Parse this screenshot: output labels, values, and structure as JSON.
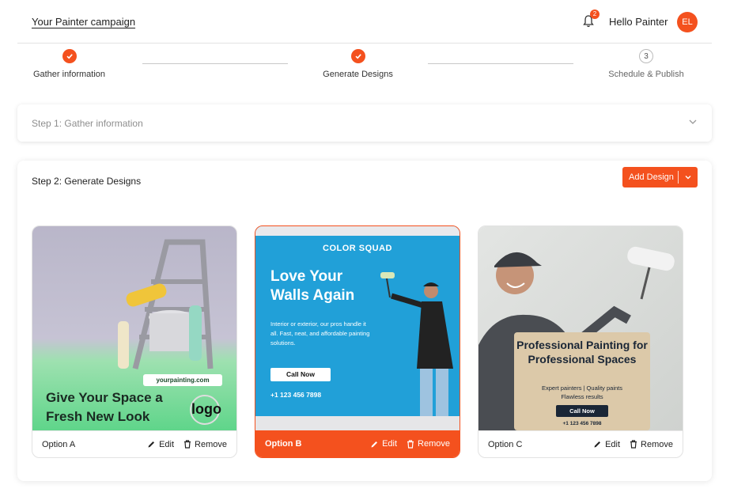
{
  "header": {
    "campaign_title": "Your Painter campaign",
    "notification_count": "2",
    "greeting": "Hello Painter",
    "avatar_initials": "EL"
  },
  "stepper": {
    "steps": [
      {
        "label": "Gather information",
        "status": "complete"
      },
      {
        "label": "Generate Designs",
        "status": "complete"
      },
      {
        "label": "Schedule & Publish",
        "status": "pending",
        "number": "3"
      }
    ]
  },
  "step1": {
    "title": "Step 1: Gather information"
  },
  "step2": {
    "title": "Step 2: Generate Designs",
    "add_button": "Add Design"
  },
  "cards": [
    {
      "option": "Option A",
      "edit": "Edit",
      "remove": "Remove",
      "ad": {
        "headline": "Give Your Space a Fresh New Look",
        "url": "yourpainting.com",
        "logo": "logo"
      }
    },
    {
      "option": "Option B",
      "selected": true,
      "edit": "Edit",
      "remove": "Remove",
      "ad": {
        "brand": "COLOR SQUAD",
        "headline": "Love Your Walls Again",
        "body": "Interior or exterior, our pros handle it all. Fast, neat, and affordable painting solutions.",
        "cta": "Call Now",
        "phone": "+1 123 456 7898"
      }
    },
    {
      "option": "Option C",
      "edit": "Edit",
      "remove": "Remove",
      "ad": {
        "headline": "Professional Painting for Professional Spaces",
        "line1": "Expert painters  |  Quality paints",
        "line2": "Flawless results",
        "cta": "Call Now",
        "phone": "+1 123 456 7898"
      }
    }
  ],
  "colors": {
    "accent": "#f4511e"
  }
}
